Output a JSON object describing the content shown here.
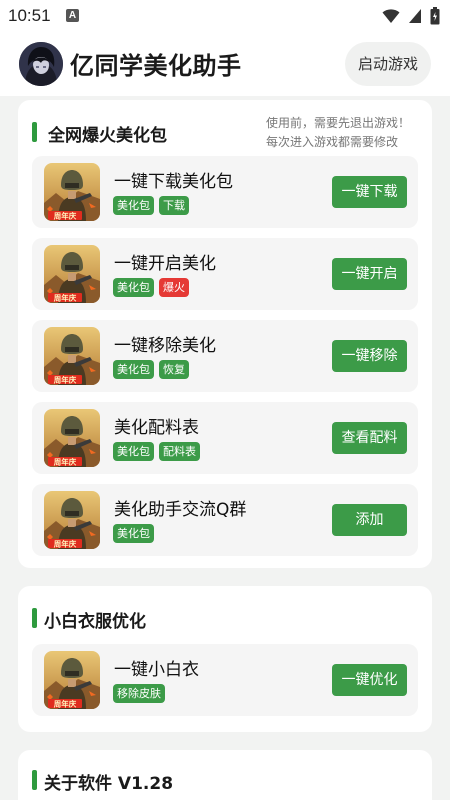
{
  "status": {
    "time": "10:51",
    "notify_glyph": "A"
  },
  "header": {
    "title": "亿同学美化助手",
    "start_label": "启动游戏"
  },
  "sections": [
    {
      "title": "全网爆火美化包",
      "note_line1": "使用前，需要先退出游戏！",
      "note_line2": "每次进入游戏都需要修改",
      "cards": [
        {
          "title": "一键下载美化包",
          "tags": [
            "美化包",
            "下载"
          ],
          "button": "一键下载"
        },
        {
          "title": "一键开启美化",
          "tags": [
            "美化包",
            "爆火"
          ],
          "button": "一键开启"
        },
        {
          "title": "一键移除美化",
          "tags": [
            "美化包",
            "恢复"
          ],
          "button": "一键移除"
        },
        {
          "title": "美化配料表",
          "tags": [
            "美化包",
            "配料表"
          ],
          "button": "查看配料"
        },
        {
          "title": "美化助手交流Q群",
          "tags": [
            "美化包"
          ],
          "button": "添加"
        }
      ]
    },
    {
      "title": "小白衣服优化",
      "cards": [
        {
          "title": "一键小白衣",
          "tags": [
            "移除皮肤"
          ],
          "button": "一键优化"
        }
      ]
    },
    {
      "title": "关于软件 V1.28"
    }
  ],
  "icon_badge": "周年庆",
  "colors": {
    "accent": "#3c9b48",
    "hot_tag": "#e53935"
  }
}
